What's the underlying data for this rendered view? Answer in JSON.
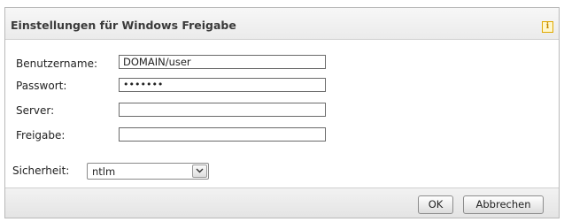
{
  "dialog": {
    "title": "Einstellungen für Windows Freigabe",
    "info_icon": "info-icon"
  },
  "fields": {
    "username_label": "Benutzername:",
    "username_value": "DOMAIN/user",
    "password_label": "Passwort:",
    "password_value": "•••••••",
    "server_label": "Server:",
    "server_value": "",
    "share_label": "Freigabe:",
    "share_value": ""
  },
  "security": {
    "label": "Sicherheit:",
    "selected": "ntlm"
  },
  "buttons": {
    "ok": "OK",
    "cancel": "Abbrechen"
  }
}
